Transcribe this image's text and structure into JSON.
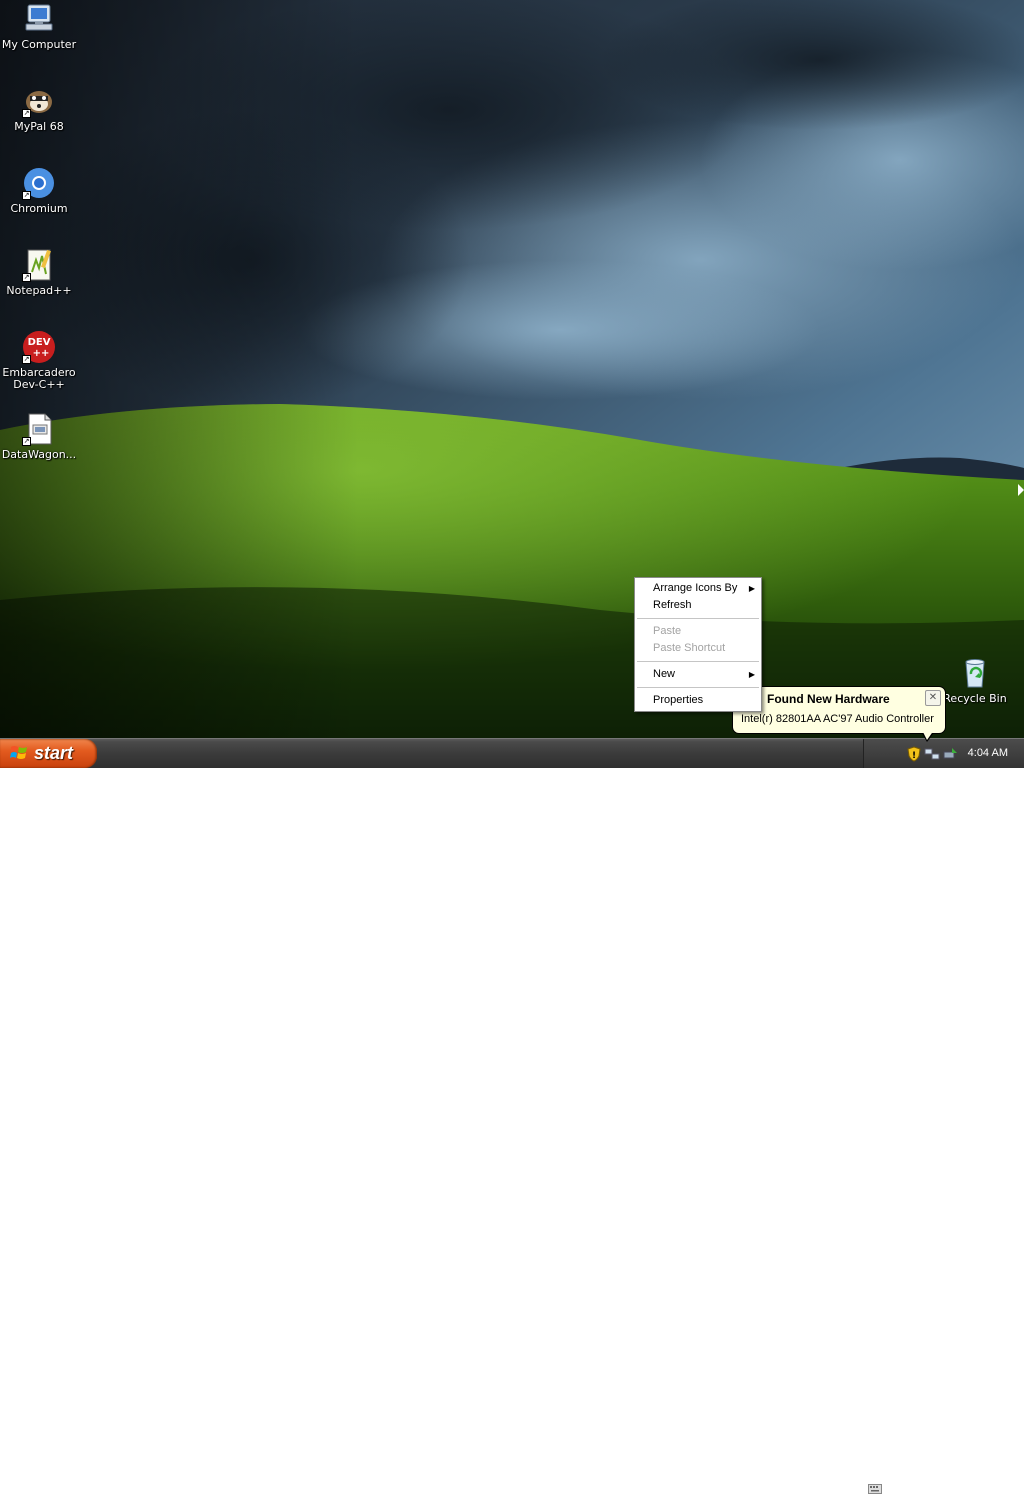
{
  "desktop": {
    "icons": [
      {
        "label": "My Computer",
        "icon": "my-computer-icon"
      },
      {
        "label": "MyPal 68",
        "icon": "mypal-icon"
      },
      {
        "label": "Chromium",
        "icon": "chromium-icon"
      },
      {
        "label": "Notepad++",
        "icon": "notepad-plus-plus-icon"
      },
      {
        "label": "Embarcadero\nDev-C++",
        "icon": "dev-cpp-icon"
      },
      {
        "label": "DataWagon...",
        "icon": "datawagon-icon"
      }
    ],
    "recycle_bin": {
      "label": "Recycle Bin",
      "icon": "recycle-bin-icon"
    }
  },
  "context_menu": {
    "items": [
      {
        "label": "Arrange Icons By",
        "submenu": true,
        "enabled": true
      },
      {
        "label": "Refresh",
        "submenu": false,
        "enabled": true
      },
      {
        "label": "Paste",
        "submenu": false,
        "enabled": false
      },
      {
        "label": "Paste Shortcut",
        "submenu": false,
        "enabled": false
      },
      {
        "label": "New",
        "submenu": true,
        "enabled": true
      },
      {
        "label": "Properties",
        "submenu": false,
        "enabled": true
      }
    ]
  },
  "balloon": {
    "title": "Found New Hardware",
    "text": "Intel(r) 82801AA AC'97 Audio Controller",
    "close_glyph": "✕"
  },
  "taskbar": {
    "start_label": "start",
    "clock": "4:04 AM"
  },
  "colors": {
    "start_button": "#e35b1f",
    "taskbar": "#3b3b3b",
    "balloon_bg": "#ffffe1",
    "grass": "#4e8a14",
    "sky": "#3d5d78"
  }
}
